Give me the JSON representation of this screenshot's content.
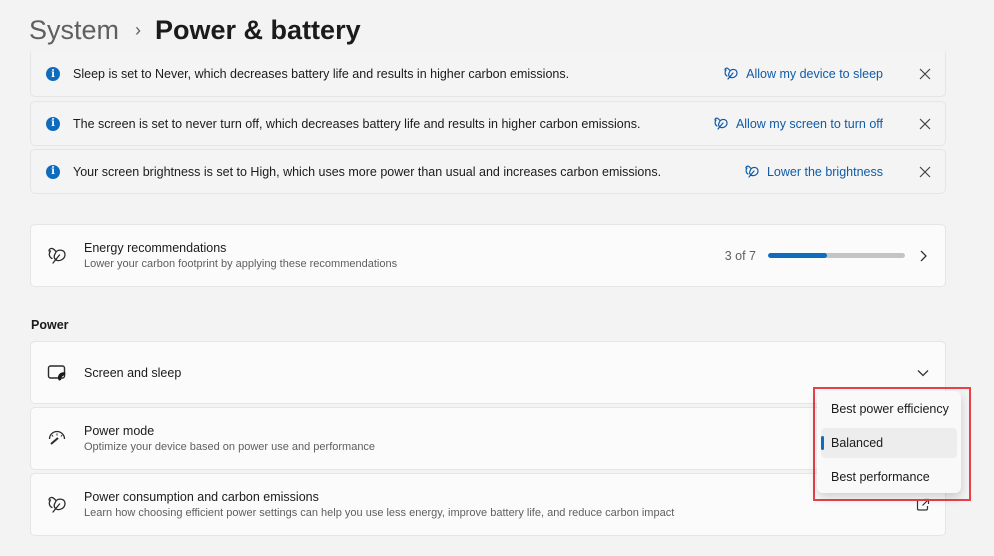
{
  "breadcrumb": {
    "parent": "System",
    "separator": "›",
    "current": "Power & battery"
  },
  "notifications": [
    {
      "message": "Sleep is set to Never, which decreases battery life and results in higher carbon emissions.",
      "action": "Allow my device to sleep",
      "icon": "info-icon",
      "action_icon": "leaf-icon",
      "close_icon": "close-icon"
    },
    {
      "message": "The screen is set to never turn off, which decreases battery life and results in higher carbon emissions.",
      "action": "Allow my screen to turn off",
      "icon": "info-icon",
      "action_icon": "leaf-icon",
      "close_icon": "close-icon"
    },
    {
      "message": "Your screen brightness is set to High, which uses more power than usual and increases carbon emissions.",
      "action": "Lower the brightness",
      "icon": "info-icon",
      "action_icon": "leaf-icon",
      "close_icon": "close-icon"
    }
  ],
  "energy_recommendations": {
    "title": "Energy recommendations",
    "subtitle": "Lower your carbon footprint by applying these recommendations",
    "progress_label": "3 of 7",
    "progress_completed": 3,
    "progress_total": 7,
    "icon": "leaf-icon",
    "chevron": "chevron-right-icon"
  },
  "power_section": {
    "label": "Power",
    "rows": [
      {
        "title": "Screen and sleep",
        "subtitle": "",
        "icon": "screen-sleep-icon",
        "right_icon": "chevron-down-icon"
      },
      {
        "title": "Power mode",
        "subtitle": "Optimize your device based on power use and performance",
        "icon": "gauge-icon"
      },
      {
        "title": "Power consumption and carbon emissions",
        "subtitle": "Learn how choosing efficient power settings can help you use less energy, improve battery life, and reduce carbon impact",
        "icon": "leaf-icon",
        "right_icon": "external-link-icon"
      }
    ]
  },
  "power_mode_dropdown": {
    "options": [
      "Best power efficiency",
      "Balanced",
      "Best performance"
    ],
    "selected": "Balanced",
    "highlight_color": "#e8414a",
    "accent_color": "#0f6cbd"
  },
  "colors": {
    "accent": "#0f6cbd",
    "link": "#0f5ba8",
    "background": "#f3f3f3"
  }
}
